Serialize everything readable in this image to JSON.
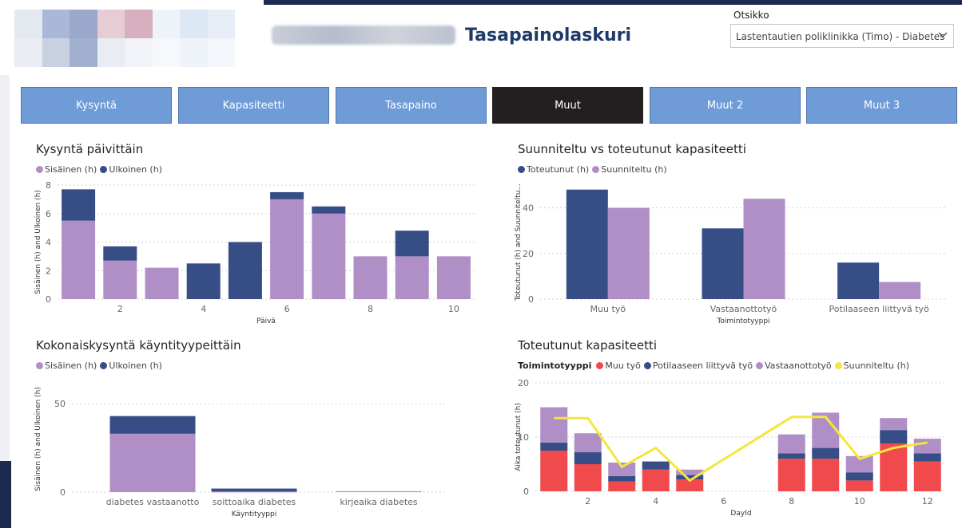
{
  "header": {
    "title": "Tasapainolaskuri",
    "filter_label": "Otsikko",
    "filter_value": "Lastentautien poliklinikka (Timo) - Diabetes"
  },
  "colors": {
    "purple": "#b08ec6",
    "navy": "#364d86",
    "red": "#f04a4d",
    "yellow": "#f5e63d",
    "tab_blue": "#6f9bd6",
    "tab_active": "#231f20"
  },
  "tabs": [
    {
      "label": "Kysyntä",
      "active": false
    },
    {
      "label": "Kapasiteetti",
      "active": false
    },
    {
      "label": "Tasapaino",
      "active": false
    },
    {
      "label": "Muut",
      "active": true
    },
    {
      "label": "Muut 2",
      "active": false
    },
    {
      "label": "Muut 3",
      "active": false
    }
  ],
  "charts": {
    "daily": {
      "title": "Kysyntä päivittäin",
      "legend": [
        "Sisäinen (h)",
        "Ulkoinen (h)"
      ]
    },
    "planned": {
      "title": "Suunniteltu vs toteutunut kapasiteetti",
      "legend": [
        "Toteutunut (h)",
        "Suunniteltu (h)"
      ]
    },
    "visit": {
      "title": "Kokonaiskysyntä käyntityypeittäin",
      "legend": [
        "Sisäinen (h)",
        "Ulkoinen (h)"
      ]
    },
    "actual": {
      "title": "Toteutunut kapasiteetti",
      "legend_title": "Toimintotyyppi",
      "legend": [
        "Muu työ",
        "Potilaaseen liittyvä työ",
        "Vastaanottotyö",
        "Suunniteltu (h)"
      ]
    }
  },
  "chart_data": [
    {
      "type": "bar",
      "stacked": true,
      "title": "Kysyntä päivittäin",
      "xlabel": "Päivä",
      "ylabel": "Sisäinen (h) and Ulkoinen (h)",
      "x": [
        1,
        2,
        3,
        4,
        5,
        6,
        7,
        8,
        9,
        10
      ],
      "x_ticks": [
        2,
        4,
        6,
        8,
        10
      ],
      "ylim": [
        0,
        8
      ],
      "y_ticks": [
        0,
        2,
        4,
        6,
        8
      ],
      "series": [
        {
          "name": "Sisäinen (h)",
          "values": [
            5.5,
            2.7,
            2.2,
            0,
            0,
            7.0,
            6.0,
            3.0,
            3.0,
            3.0
          ]
        },
        {
          "name": "Ulkoinen (h)",
          "values": [
            2.2,
            1.0,
            0,
            2.5,
            4.0,
            0.5,
            0.5,
            0,
            1.8,
            0
          ]
        }
      ],
      "legend_position": "top-left",
      "grid": true
    },
    {
      "type": "bar",
      "stacked": false,
      "title": "Suunniteltu vs toteutunut kapasiteetti",
      "xlabel": "Toimintotyyppi",
      "ylabel": "Toteutunut (h) and Suunniteltu...",
      "categories": [
        "Muu työ",
        "Vastaanottotyö",
        "Potilaaseen liittyvä työ"
      ],
      "ylim": [
        0,
        50
      ],
      "y_ticks": [
        0,
        20,
        40
      ],
      "series": [
        {
          "name": "Toteutunut (h)",
          "values": [
            48,
            31,
            16
          ]
        },
        {
          "name": "Suunniteltu (h)",
          "values": [
            40,
            44,
            7.5
          ]
        }
      ],
      "legend_position": "top-left",
      "grid": true
    },
    {
      "type": "bar",
      "stacked": true,
      "title": "Kokonaiskysyntä käyntityypeittäin",
      "xlabel": "Käyntityyppi",
      "ylabel": "Sisäinen (h) and Ulkoinen (h)",
      "categories": [
        "diabetes vastaanotto",
        "soittoaika diabetes",
        "kirjeaika diabetes"
      ],
      "ylim": [
        0,
        60
      ],
      "y_ticks": [
        0,
        50
      ],
      "series": [
        {
          "name": "Sisäinen (h)",
          "values": [
            33,
            0.3,
            0.5
          ]
        },
        {
          "name": "Ulkoinen (h)",
          "values": [
            10,
            1.7,
            0
          ]
        }
      ],
      "legend_position": "top-left",
      "grid": true
    },
    {
      "type": "bar",
      "stacked": true,
      "title": "Toteutunut kapasiteetti",
      "xlabel": "DayId",
      "ylabel": "Aika toteutunut (h)",
      "x": [
        1,
        2,
        3,
        4,
        5,
        6,
        7,
        8,
        9,
        10,
        11,
        12
      ],
      "x_ticks": [
        2,
        4,
        6,
        8,
        10,
        12
      ],
      "ylim": [
        0,
        20
      ],
      "y_ticks": [
        0,
        10,
        20
      ],
      "series": [
        {
          "name": "Muu työ",
          "values": [
            7.5,
            5.0,
            1.8,
            4.0,
            2.2,
            0,
            0,
            6.0,
            6.0,
            2.0,
            8.8,
            5.5
          ]
        },
        {
          "name": "Potilaaseen liittyvä työ",
          "values": [
            1.5,
            2.2,
            1.0,
            1.5,
            0.8,
            0,
            0,
            1.0,
            2.0,
            1.5,
            2.5,
            1.5
          ]
        },
        {
          "name": "Vastaanottotyö",
          "values": [
            6.5,
            3.5,
            2.5,
            0,
            1.0,
            0,
            0,
            3.5,
            6.5,
            3.0,
            2.2,
            2.7
          ]
        },
        {
          "name": "Suunniteltu (h)",
          "type": "line",
          "values": [
            13.5,
            13.5,
            4.5,
            8.0,
            2.0,
            null,
            null,
            13.7,
            13.7,
            6.0,
            8.0,
            9.0
          ]
        }
      ],
      "legend_position": "top-left",
      "grid": true
    }
  ]
}
